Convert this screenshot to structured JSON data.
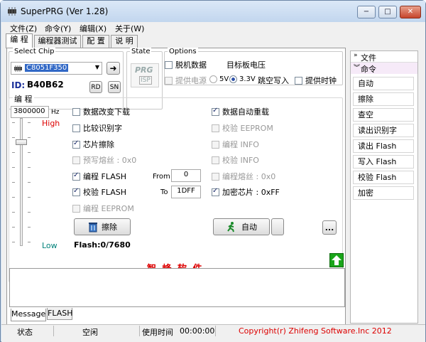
{
  "window": {
    "title": "SuperPRG (Ver 1.28)",
    "minimize": "−",
    "maximize": "□",
    "close": "✕"
  },
  "menu": [
    "文件(Z)",
    "命令(Y)",
    "编辑(X)",
    "关于(W)"
  ],
  "tabs": [
    "编 程",
    "编程器测试",
    "配 置",
    "说 明"
  ],
  "select_chip": {
    "label": "Select Chip",
    "value": "C8051F350",
    "id_label": "ID:",
    "id_value": "B40B62",
    "rd": "RD",
    "sn": "SN"
  },
  "state": {
    "label": "State",
    "logo_top": "PRG",
    "logo_bottom": "ISP"
  },
  "options": {
    "label": "Options",
    "offline": "脱机数据",
    "target_volt": "目标板电压",
    "power": "提供电源",
    "v5": "5V",
    "v33": "3.3V",
    "skip_write": "跳空写入",
    "clock": "提供时钟"
  },
  "program": {
    "label": "编 程",
    "freq": "3800000",
    "freq_unit": "Hz",
    "high": "High",
    "low": "Low",
    "left_checks": [
      {
        "label": "数据改变下载",
        "checked": false,
        "disabled": false
      },
      {
        "label": "比较识别字",
        "checked": false,
        "disabled": false
      },
      {
        "label": "芯片擦除",
        "checked": true,
        "disabled": false
      },
      {
        "label": "预写熔丝 : 0x0",
        "checked": false,
        "disabled": true
      },
      {
        "label": "编程 FLASH",
        "checked": true,
        "disabled": false
      },
      {
        "label": "校验 FLASH",
        "checked": true,
        "disabled": false
      },
      {
        "label": "编程 EEPROM",
        "checked": false,
        "disabled": true
      }
    ],
    "right_checks": [
      {
        "label": "数据自动重载",
        "checked": true,
        "disabled": false
      },
      {
        "label": "校验 EEPROM",
        "checked": false,
        "disabled": true
      },
      {
        "label": "编程 INFO",
        "checked": false,
        "disabled": true
      },
      {
        "label": "校验 INFO",
        "checked": false,
        "disabled": true
      },
      {
        "label": "编程熔丝 : 0x0",
        "checked": false,
        "disabled": true
      },
      {
        "label": "加密芯片 : 0xFF",
        "checked": true,
        "disabled": false
      }
    ],
    "from_label": "From",
    "from_value": "0",
    "to_label": "To",
    "to_value": "1DFF",
    "erase": "擦除",
    "auto": "自动",
    "more": "...",
    "flash_status": "Flash:0/7680"
  },
  "banner": "智 峰 软 件",
  "bottom_tabs": [
    "Message",
    "FLASH"
  ],
  "side": {
    "file": "文件",
    "command": "命令",
    "buttons": [
      "自动",
      "擦除",
      "查空",
      "读出识别字",
      "读出 Flash",
      "写入 Flash",
      "校验 Flash",
      "加密"
    ]
  },
  "status": {
    "state_label": "状态",
    "state_value": "空闲",
    "time_label": "使用时间",
    "time_value": "00:00:00",
    "copyright": "Copyright(r) Zhifeng Software.Inc 2012"
  }
}
